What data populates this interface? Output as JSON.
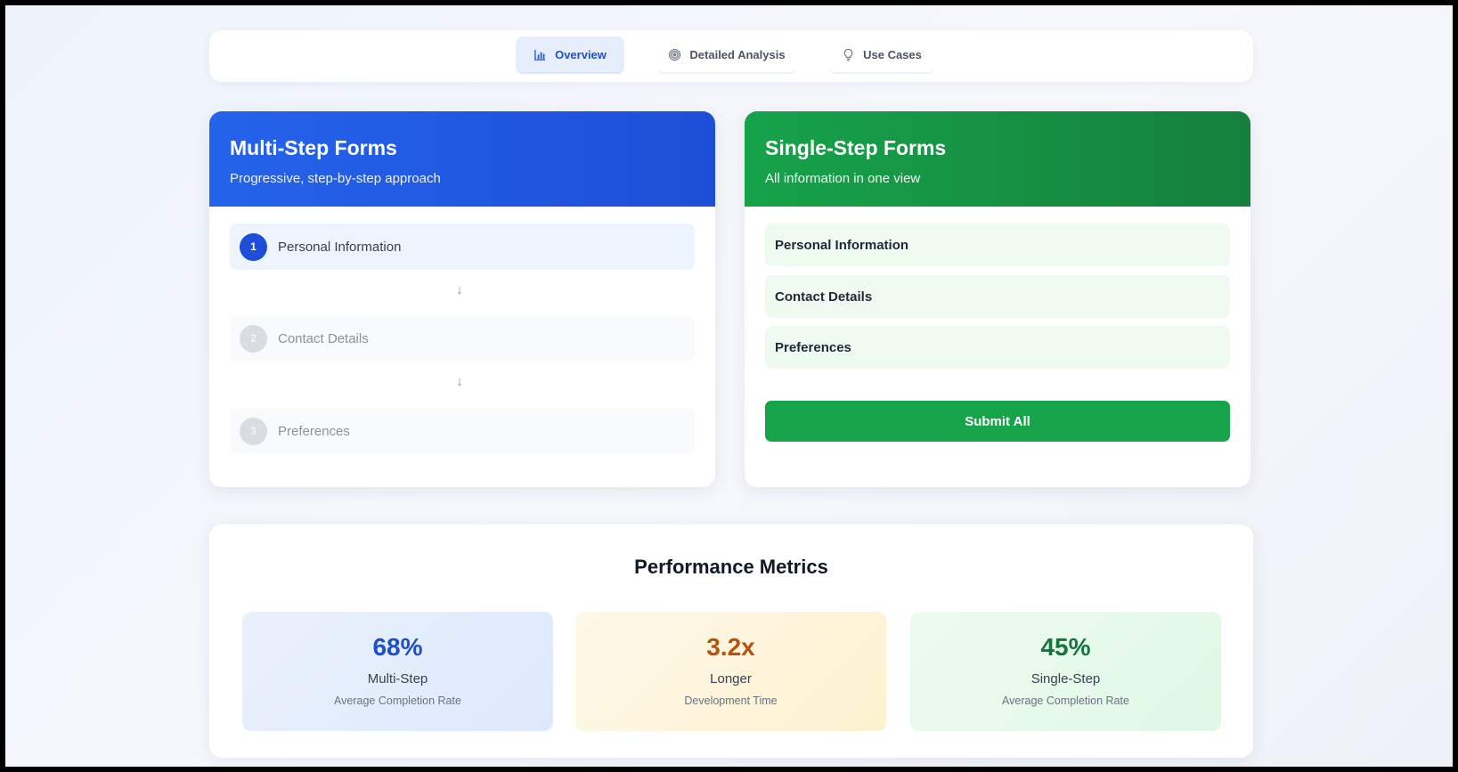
{
  "tabs": [
    {
      "label": "Overview",
      "icon": "bar-chart-icon",
      "active": true
    },
    {
      "label": "Detailed Analysis",
      "icon": "target-icon",
      "active": false
    },
    {
      "label": "Use Cases",
      "icon": "lightbulb-icon",
      "active": false
    }
  ],
  "multi": {
    "title": "Multi-Step Forms",
    "subtitle": "Progressive, step-by-step approach",
    "steps": [
      {
        "num": "1",
        "label": "Personal Information"
      },
      {
        "num": "2",
        "label": "Contact Details"
      },
      {
        "num": "3",
        "label": "Preferences"
      }
    ]
  },
  "single": {
    "title": "Single-Step Forms",
    "subtitle": "All information in one view",
    "fields": [
      "Personal Information",
      "Contact Details",
      "Preferences"
    ],
    "submit_label": "Submit All"
  },
  "metrics": {
    "title": "Performance Metrics",
    "items": [
      {
        "value": "68%",
        "label": "Multi-Step",
        "sub": "Average Completion Rate"
      },
      {
        "value": "3.2x",
        "label": "Longer",
        "sub": "Development Time"
      },
      {
        "value": "45%",
        "label": "Single-Step",
        "sub": "Average Completion Rate"
      }
    ]
  },
  "colors": {
    "primary_blue": "#1d4ed8",
    "primary_green": "#16a34a",
    "amber": "#b4530b"
  }
}
